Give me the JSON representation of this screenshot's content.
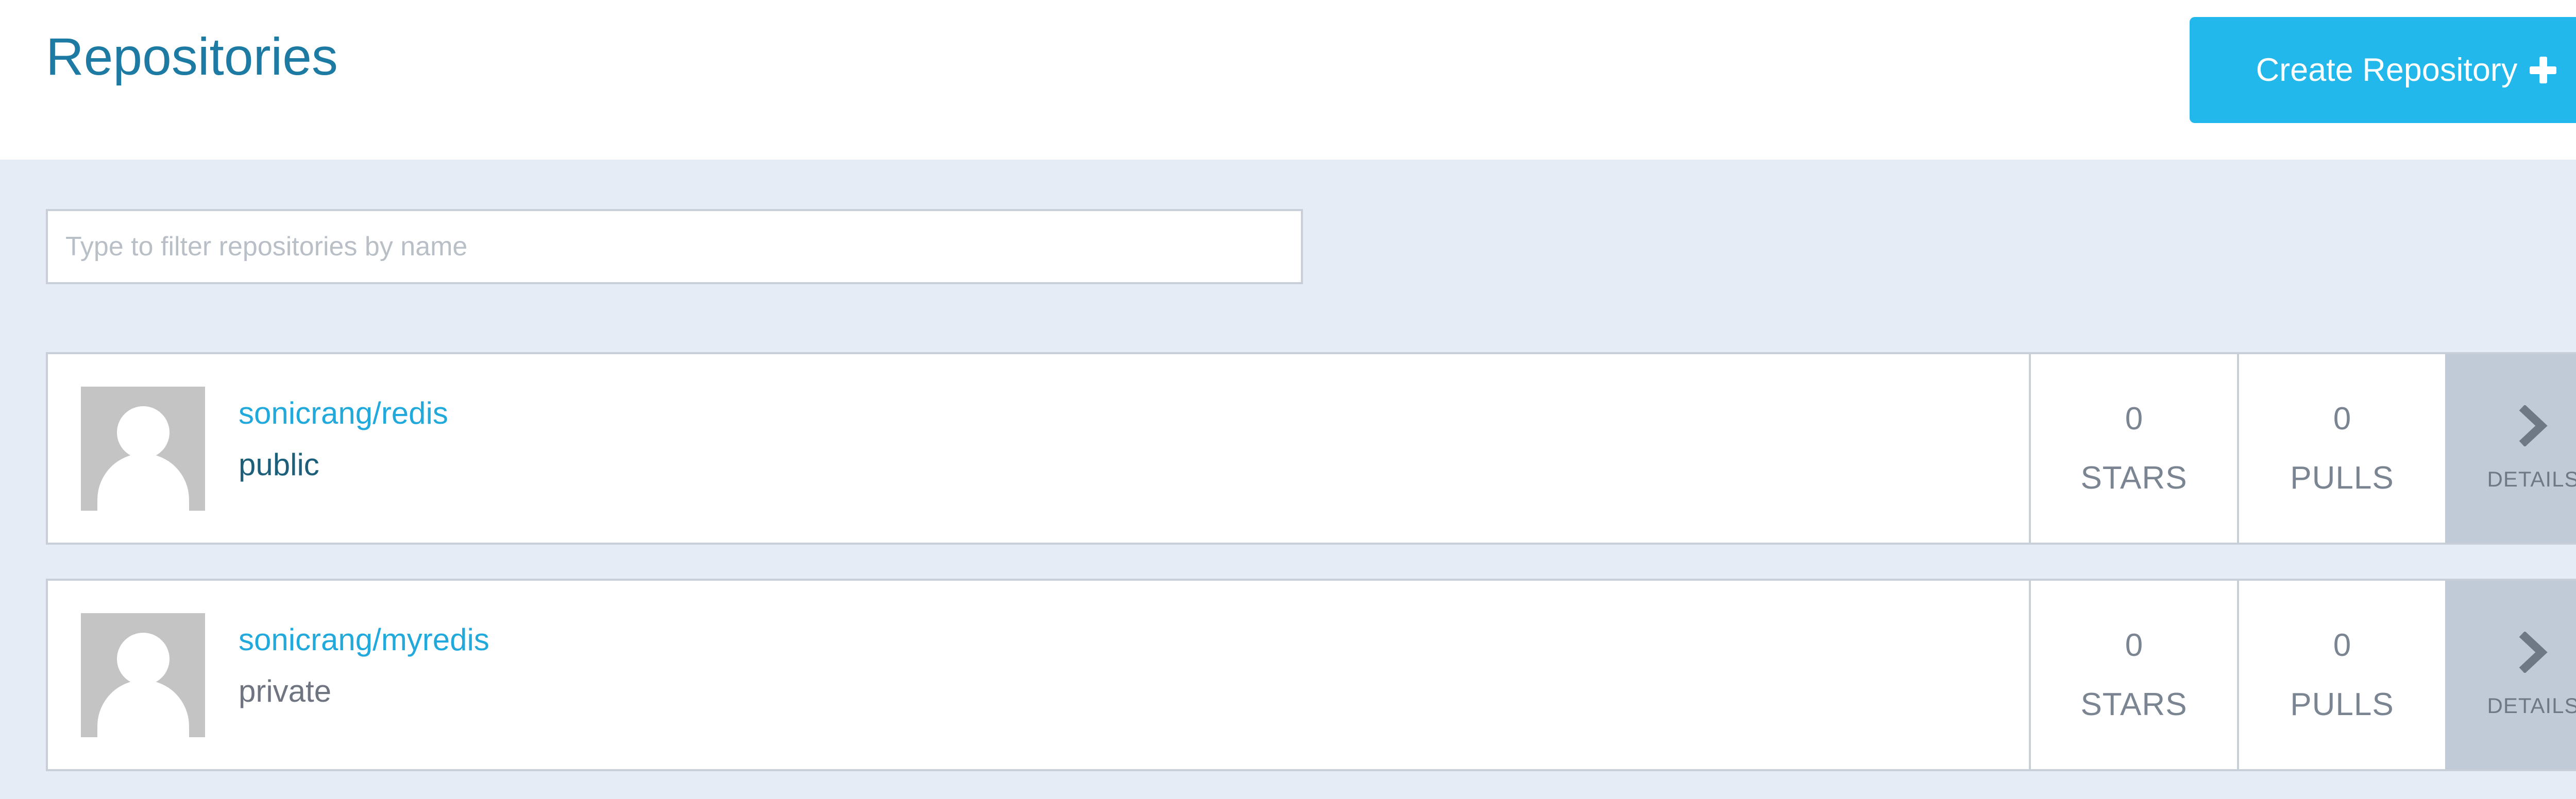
{
  "header": {
    "title": "Repositories",
    "create_button_label": "Create Repository"
  },
  "filter": {
    "placeholder": "Type to filter repositories by name",
    "value": ""
  },
  "colors": {
    "accent": "#22b8eb",
    "title": "#1c7aa3",
    "page_background": "#e5ecf5",
    "details_background": "#c1cbd8"
  },
  "repositories": [
    {
      "name": "sonicrang/redis",
      "visibility": "public",
      "visibility_color": "#1d5f7a",
      "stars": "0",
      "stars_label": "STARS",
      "pulls": "0",
      "pulls_label": "PULLS",
      "details_label": "DETAILS",
      "avatar_icon": "default-user-avatar",
      "details_icon": "chevron-right-icon"
    },
    {
      "name": "sonicrang/myredis",
      "visibility": "private",
      "visibility_color": "#6e7580",
      "stars": "0",
      "stars_label": "STARS",
      "pulls": "0",
      "pulls_label": "PULLS",
      "details_label": "DETAILS",
      "avatar_icon": "default-user-avatar",
      "details_icon": "chevron-right-icon"
    }
  ]
}
